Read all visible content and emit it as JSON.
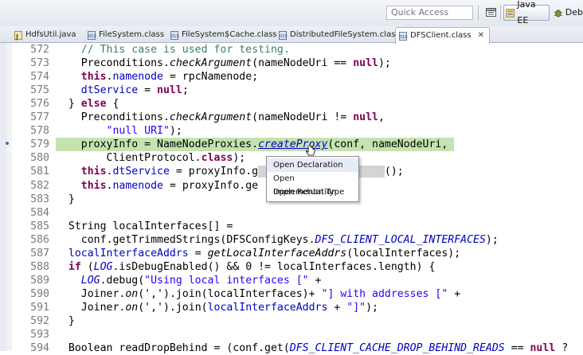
{
  "toolbar": {
    "quick_access_placeholder": "Quick Access",
    "perspectives": [
      {
        "label": "Java EE",
        "active": true
      },
      {
        "label": "Debu",
        "active": false
      }
    ]
  },
  "tabs": [
    {
      "label": "HdfsUtil.java",
      "icon": "java-file-icon"
    },
    {
      "label": "FileSystem.class",
      "icon": "class-file-icon"
    },
    {
      "label": "FileSystem$Cache.class",
      "icon": "class-file-icon"
    },
    {
      "label": "DistributedFileSystem.class",
      "icon": "class-file-icon"
    },
    {
      "label": "DFSClient.class",
      "icon": "class-file-icon",
      "active": true
    }
  ],
  "editor": {
    "lines": [
      {
        "n": "572",
        "t": [
          [
            "cm",
            "    // This case is used for testing."
          ]
        ]
      },
      {
        "n": "573",
        "t": [
          [
            "",
            "    Preconditions."
          ],
          [
            "it",
            "checkArgument"
          ],
          [
            "",
            "(nameNodeUri == "
          ],
          [
            "kw",
            "null"
          ],
          [
            "",
            ");"
          ]
        ]
      },
      {
        "n": "574",
        "t": [
          [
            "kw",
            "    this"
          ],
          [
            "",
            "."
          ],
          [
            "fd",
            "namenode"
          ],
          [
            "",
            " = rpcNamenode;"
          ]
        ]
      },
      {
        "n": "575",
        "t": [
          [
            "fd",
            "    dtService"
          ],
          [
            "",
            " = "
          ],
          [
            "kw",
            "null"
          ],
          [
            "",
            ";"
          ]
        ]
      },
      {
        "n": "576",
        "t": [
          [
            "",
            "  } "
          ],
          [
            "kw",
            "else"
          ],
          [
            "",
            " {"
          ]
        ]
      },
      {
        "n": "577",
        "t": [
          [
            "",
            "    Preconditions."
          ],
          [
            "it",
            "checkArgument"
          ],
          [
            "",
            "(nameNodeUri != "
          ],
          [
            "kw",
            "null"
          ],
          [
            "",
            ","
          ]
        ]
      },
      {
        "n": "578",
        "t": [
          [
            "st",
            "        \"null URI\""
          ],
          [
            "",
            ");"
          ]
        ]
      },
      {
        "n": "579",
        "t": [
          [
            "",
            "    proxyInfo = NameNodeProxies."
          ],
          [
            "lnk",
            "createProxy"
          ],
          [
            "",
            "(conf, nameNodeUri,"
          ]
        ],
        "highlight": true,
        "marker": true
      },
      {
        "n": "580",
        "t": [
          [
            "",
            "        ClientProtocol."
          ],
          [
            "kw",
            "class"
          ],
          [
            "",
            ");"
          ]
        ]
      },
      {
        "n": "581",
        "t": [
          [
            "kw",
            "    this"
          ],
          [
            "",
            "."
          ],
          [
            "fd",
            "dtService"
          ],
          [
            "",
            " = proxyInfo.g"
          ],
          [
            "occ",
            "                    "
          ],
          [
            "",
            "();"
          ]
        ]
      },
      {
        "n": "582",
        "t": [
          [
            "kw",
            "    this"
          ],
          [
            "",
            "."
          ],
          [
            "fd",
            "namenode"
          ],
          [
            "",
            " = proxyInfo.ge"
          ]
        ]
      },
      {
        "n": "583",
        "t": [
          [
            "",
            "  }"
          ]
        ]
      },
      {
        "n": "584",
        "t": [
          [
            "",
            ""
          ]
        ]
      },
      {
        "n": "585",
        "t": [
          [
            "",
            "  String localInterfaces[] ="
          ]
        ]
      },
      {
        "n": "586",
        "t": [
          [
            "",
            "    conf.getTrimmedStrings(DFSConfigKeys."
          ],
          [
            "sf",
            "DFS_CLIENT_LOCAL_INTERFACES"
          ],
          [
            "",
            ");"
          ]
        ]
      },
      {
        "n": "587",
        "t": [
          [
            "fd",
            "  localInterfaceAddrs"
          ],
          [
            "",
            " = "
          ],
          [
            "it",
            "getLocalInterfaceAddrs"
          ],
          [
            "",
            "(localInterfaces);"
          ]
        ]
      },
      {
        "n": "588",
        "t": [
          [
            "kw",
            "  if"
          ],
          [
            "",
            " ("
          ],
          [
            "sf",
            "LOG"
          ],
          [
            "",
            ".isDebugEnabled() && 0 != localInterfaces.length) {"
          ]
        ]
      },
      {
        "n": "589",
        "t": [
          [
            "sf",
            "    LOG"
          ],
          [
            "",
            ".debug("
          ],
          [
            "st",
            "\"Using local interfaces [\""
          ],
          [
            "",
            " +"
          ]
        ]
      },
      {
        "n": "590",
        "t": [
          [
            "",
            "    Joiner."
          ],
          [
            "it",
            "on"
          ],
          [
            "",
            "(','"
          ],
          [
            "",
            ").join(localInterfaces)+ "
          ],
          [
            "st",
            "\"] with addresses [\""
          ],
          [
            "",
            " +"
          ]
        ]
      },
      {
        "n": "591",
        "t": [
          [
            "",
            "    Joiner."
          ],
          [
            "it",
            "on"
          ],
          [
            "",
            "(',').join("
          ],
          [
            "fd",
            "localInterfaceAddrs"
          ],
          [
            "",
            " + "
          ],
          [
            "st",
            "\"]\""
          ],
          [
            "",
            ");"
          ]
        ]
      },
      {
        "n": "592",
        "t": [
          [
            "",
            "  }"
          ]
        ]
      },
      {
        "n": "593",
        "t": [
          [
            "",
            ""
          ]
        ]
      },
      {
        "n": "594",
        "t": [
          [
            "",
            "  Boolean readDropBehind = (conf.get("
          ],
          [
            "sf",
            "DFS_CLIENT_CACHE_DROP_BEHIND_READS"
          ],
          [
            "",
            " == "
          ],
          [
            "kw",
            "null"
          ],
          [
            "",
            " ?"
          ]
        ]
      }
    ]
  },
  "popup": {
    "items": [
      "Open Declaration",
      "Open Implementation",
      "Open Return Type"
    ],
    "selected": 0
  },
  "colors": {
    "keyword": "#7f0055",
    "comment": "#3f7f5f",
    "string": "#2a00ff",
    "field": "#0000c0",
    "current_line": "#c5e3b0"
  }
}
